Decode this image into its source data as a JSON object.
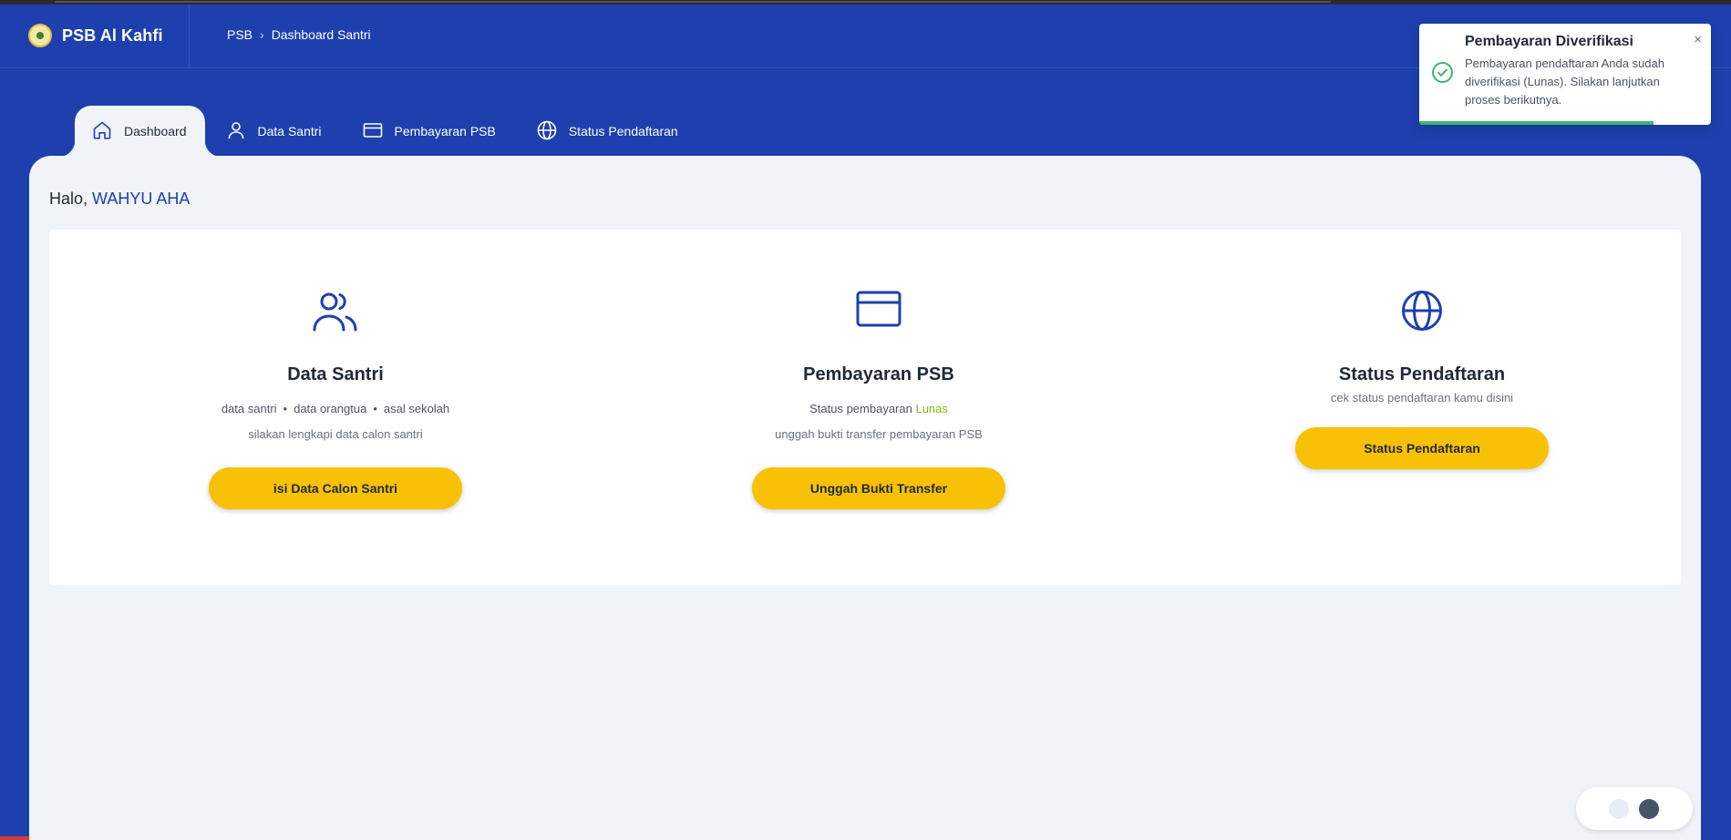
{
  "header": {
    "brand": "PSB Al Kahfi",
    "breadcrumb": [
      "PSB",
      "Dashboard Santri"
    ],
    "breadcrumb_separator": "›"
  },
  "tabs": [
    {
      "label": "Dashboard",
      "icon": "home-icon",
      "active": true
    },
    {
      "label": "Data Santri",
      "icon": "user-icon",
      "active": false
    },
    {
      "label": "Pembayaran PSB",
      "icon": "credit-card-icon",
      "active": false
    },
    {
      "label": "Status Pendaftaran",
      "icon": "globe-icon",
      "active": false
    }
  ],
  "greeting": {
    "prefix": "Halo,",
    "user": "WAHYU AHA"
  },
  "cards": {
    "data_santri": {
      "icon": "users-icon",
      "title": "Data Santri",
      "items": [
        "data santri",
        "data orangtua",
        "asal sekolah"
      ],
      "subtitle": "silakan lengkapi data calon santri",
      "button": "isi Data Calon Santri"
    },
    "pembayaran": {
      "icon": "credit-card-icon",
      "title": "Pembayaran PSB",
      "status_prefix": "Status pembayaran",
      "status_value": "Lunas",
      "subtitle": "unggah bukti transfer pembayaran PSB",
      "button": "Unggah Bukti Transfer"
    },
    "status": {
      "icon": "globe-icon",
      "title": "Status Pendaftaran",
      "subtitle": "cek status pendaftaran kamu disini",
      "button": "Status Pendaftaran"
    }
  },
  "toast": {
    "title": "Pembayaran Diverifikasi",
    "message": "Pembayaran pendaftaran Anda sudah diverifikasi (Lunas). Silakan lanjutkan proses berikutnya.",
    "close": "×",
    "icon": "check-circle-icon"
  },
  "colors": {
    "primary": "#1e40af",
    "accent": "#f9c106",
    "success": "#3fb56b",
    "paid": "#84b817"
  }
}
